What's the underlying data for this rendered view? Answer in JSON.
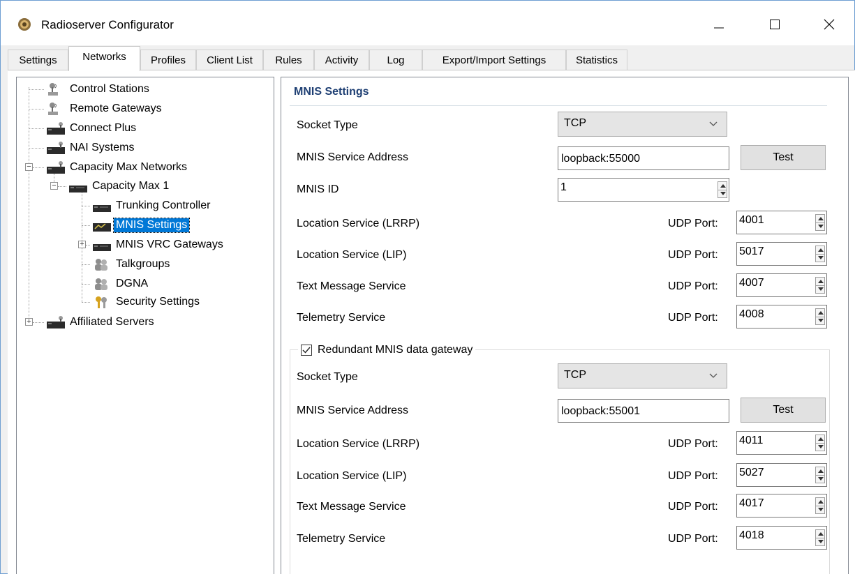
{
  "window": {
    "title": "Radioserver Configurator"
  },
  "tabs": [
    {
      "label": "Settings"
    },
    {
      "label": "Networks",
      "active": true
    },
    {
      "label": "Profiles"
    },
    {
      "label": "Client List"
    },
    {
      "label": "Rules"
    },
    {
      "label": "Activity"
    },
    {
      "label": "Log"
    },
    {
      "label": "Export/Import Settings"
    },
    {
      "label": "Statistics"
    }
  ],
  "tree": {
    "items": [
      {
        "label": "Control Stations",
        "icon": "antenna-tower-icon"
      },
      {
        "label": "Remote Gateways",
        "icon": "antenna-tower-icon"
      },
      {
        "label": "Connect Plus",
        "icon": "network-device-icon"
      },
      {
        "label": "NAI Systems",
        "icon": "network-device-icon"
      },
      {
        "label": "Capacity Max Networks",
        "icon": "network-device-icon",
        "expanded": true
      },
      {
        "label": "Capacity Max 1",
        "icon": "network-device-icon",
        "expanded": true
      },
      {
        "label": "Trunking Controller",
        "icon": "network-device-icon"
      },
      {
        "label": "MNIS Settings",
        "icon": "mnis-device-icon",
        "selected": true
      },
      {
        "label": "MNIS VRC Gateways",
        "icon": "network-device-icon",
        "expanded": false
      },
      {
        "label": "Talkgroups",
        "icon": "users-icon"
      },
      {
        "label": "DGNA",
        "icon": "users-icon"
      },
      {
        "label": "Security Settings",
        "icon": "keys-icon"
      },
      {
        "label": "Affiliated Servers",
        "icon": "network-device-icon",
        "expanded": false
      }
    ]
  },
  "mnis": {
    "title": "MNIS Settings",
    "socket_type_label": "Socket Type",
    "socket_type_value": "TCP",
    "service_address_label": "MNIS Service Address",
    "service_address_value": "loopback:55000",
    "test_label": "Test",
    "mnis_id_label": "MNIS ID",
    "mnis_id_value": "1",
    "udp_port_label": "UDP Port:",
    "services": [
      {
        "label": "Location Service (LRRP)",
        "port": "4001"
      },
      {
        "label": "Location Service (LIP)",
        "port": "5017"
      },
      {
        "label": "Text Message Service",
        "port": "4007"
      },
      {
        "label": "Telemetry Service",
        "port": "4008"
      }
    ]
  },
  "redundant": {
    "checkbox_label": "Redundant MNIS data gateway",
    "checked": true,
    "socket_type_label": "Socket Type",
    "socket_type_value": "TCP",
    "service_address_label": "MNIS Service Address",
    "service_address_value": "loopback:55001",
    "test_label": "Test",
    "udp_port_label": "UDP Port:",
    "services": [
      {
        "label": "Location Service (LRRP)",
        "port": "4011"
      },
      {
        "label": "Location Service (LIP)",
        "port": "5027"
      },
      {
        "label": "Text Message Service",
        "port": "4017"
      },
      {
        "label": "Telemetry Service",
        "port": "4018"
      }
    ]
  }
}
